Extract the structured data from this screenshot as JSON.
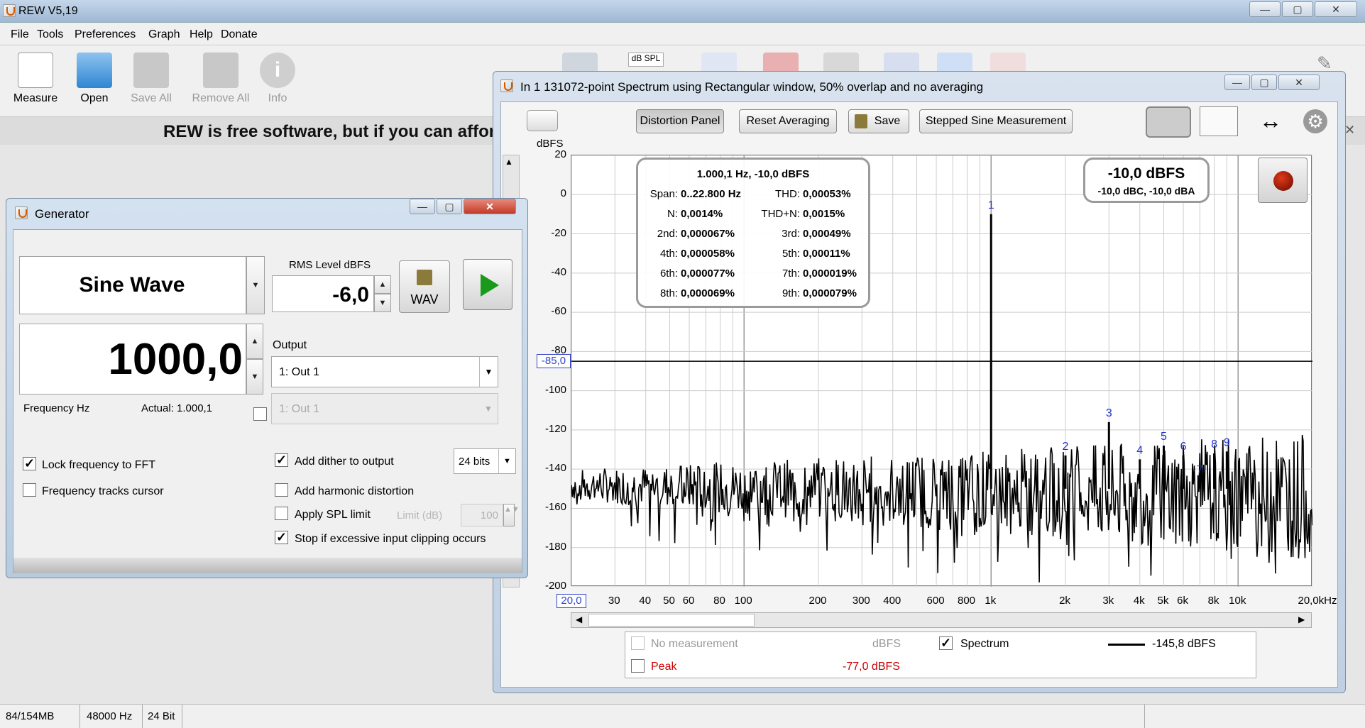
{
  "app": {
    "title": "REW V5,19"
  },
  "menu": [
    "File",
    "Tools",
    "Preferences",
    "Graph",
    "Help",
    "Donate"
  ],
  "toolbar": [
    {
      "label": "Measure",
      "enabled": true
    },
    {
      "label": "Open",
      "enabled": true
    },
    {
      "label": "Save All",
      "enabled": false
    },
    {
      "label": "Remove All",
      "enabled": false
    },
    {
      "label": "Info",
      "enabled": false
    }
  ],
  "banner": "REW is free software, but if you can affor",
  "spectrum": {
    "title": "In 1 131072-point Spectrum using Rectangular window, 50% overlap and no averaging",
    "buttons": {
      "distortion": "Distortion Panel",
      "reset": "Reset Averaging",
      "save": "Save",
      "stepped": "Stepped Sine Measurement"
    },
    "yunit": "dBFS",
    "cursor_y": "-85,0",
    "x_start": "20,0",
    "level": {
      "main": "-10,0 dBFS",
      "sub": "-10,0 dBC, -10,0 dBA"
    },
    "dist": {
      "header": "1.000,1 Hz, -10,0 dBFS",
      "span_label": "Span:",
      "span": "0..22.800 Hz",
      "thd_label": "THD:",
      "thd": "0,00053%",
      "n_label": "N:",
      "n": "0,0014%",
      "thdn_label": "THD+N:",
      "thdn": "0,0015%",
      "h2_label": "2nd:",
      "h2": "0,000067%",
      "h3_label": "3rd:",
      "h3": "0,00049%",
      "h4_label": "4th:",
      "h4": "0,000058%",
      "h5_label": "5th:",
      "h5": "0,00011%",
      "h6_label": "6th:",
      "h6": "0,000077%",
      "h7_label": "7th:",
      "h7": "0,000019%",
      "h8_label": "8th:",
      "h8": "0,000069%",
      "h9_label": "9th:",
      "h9": "0,000079%"
    },
    "legend": {
      "nomeas": "No measurement",
      "nomeas_unit": "dBFS",
      "spectrum": "Spectrum",
      "spectrum_value": "-145,8 dBFS",
      "peak": "Peak",
      "peak_value": "-77,0 dBFS"
    }
  },
  "chart_data": {
    "type": "line",
    "xscale": "log",
    "ylabel": "dBFS",
    "ylim": [
      -200,
      20
    ],
    "yticks": [
      "20",
      "0",
      "-20",
      "-40",
      "-60",
      "-80",
      "-100",
      "-120",
      "-140",
      "-160",
      "-180",
      "-200"
    ],
    "xticks": [
      "30",
      "40",
      "50",
      "60",
      "80",
      "100",
      "200",
      "300",
      "400",
      "600",
      "800",
      "1k",
      "2k",
      "3k",
      "4k",
      "5k",
      "6k",
      "8k",
      "10k",
      "20,0kHz"
    ],
    "series": [
      {
        "name": "Spectrum",
        "fundamental_hz": 1000,
        "fundamental_db": -10
      }
    ],
    "harmonics": [
      {
        "label": "1",
        "hz": 1000,
        "db": -10
      },
      {
        "label": "2",
        "hz": 2000,
        "db": -133
      },
      {
        "label": "3",
        "hz": 3000,
        "db": -116
      },
      {
        "label": "4",
        "hz": 4000,
        "db": -135
      },
      {
        "label": "5",
        "hz": 5000,
        "db": -128
      },
      {
        "label": "6",
        "hz": 6000,
        "db": -133
      },
      {
        "label": "7",
        "hz": 7000,
        "db": -145
      },
      {
        "label": "8",
        "hz": 8000,
        "db": -132
      },
      {
        "label": "9",
        "hz": 9000,
        "db": -131
      }
    ]
  },
  "generator": {
    "title": "Generator",
    "signal": "Sine Wave",
    "rms_label": "RMS Level dBFS",
    "rms": "-6,0",
    "wav": "WAV",
    "freq": "1000,0",
    "freq_label": "Frequency Hz",
    "actual": "Actual: 1.000,1",
    "output_label": "Output",
    "output": "1: Out 1",
    "output2": "1: Out 1",
    "lock": "Lock frequency to FFT",
    "tracks": "Frequency tracks cursor",
    "dither": "Add dither to output",
    "bits": "24 bits",
    "harm": "Add harmonic distortion",
    "spl": "Apply SPL limit",
    "limit_label": "Limit (dB)",
    "limit": "100",
    "stop": "Stop if excessive input clipping occurs"
  },
  "status": {
    "mem": "84/154MB",
    "rate": "48000 Hz",
    "bits": "24 Bit"
  }
}
